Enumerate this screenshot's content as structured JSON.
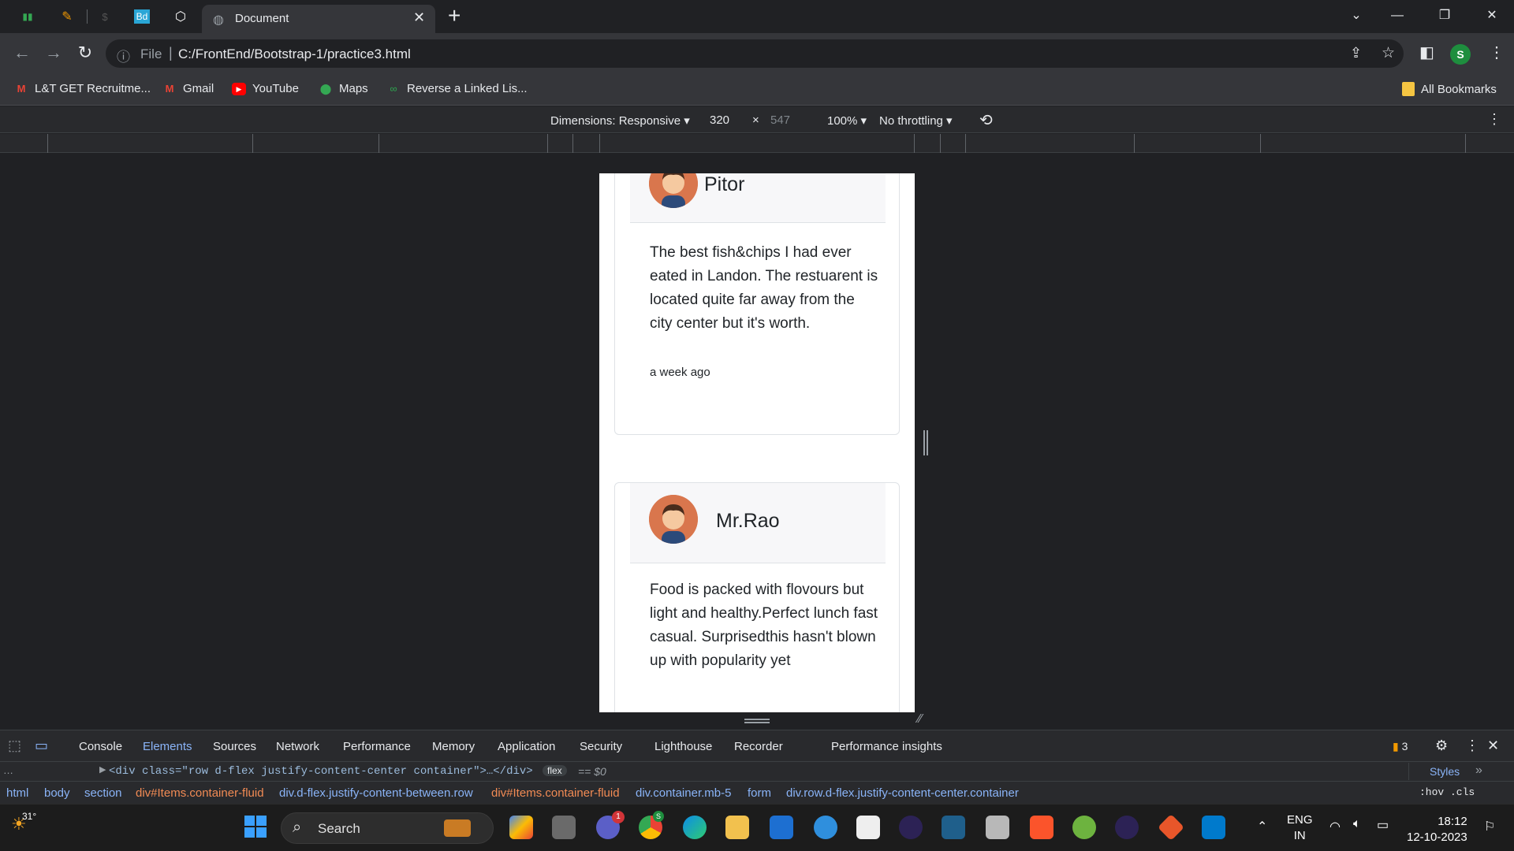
{
  "browser": {
    "tab_title": "Document",
    "url_prefix": "File",
    "url": "C:/FrontEnd/Bootstrap-1/practice3.html",
    "profile_initial": "S"
  },
  "bookmarks": [
    {
      "label": "L&T GET Recruitme...",
      "icon": "gmail-icon"
    },
    {
      "label": "Gmail",
      "icon": "gmail-icon"
    },
    {
      "label": "YouTube",
      "icon": "youtube-icon"
    },
    {
      "label": "Maps",
      "icon": "maps-icon"
    },
    {
      "label": "Reverse a Linked Lis...",
      "icon": "link-icon"
    }
  ],
  "all_bookmarks": "All Bookmarks",
  "device_toolbar": {
    "dimensions": "Dimensions: Responsive",
    "width": "320",
    "times": "×",
    "height": "547",
    "zoom": "100%",
    "throttling": "No throttling"
  },
  "page": {
    "reviews": [
      {
        "name": "Pitor",
        "text": "The best fish&chips I had ever eated in Landon. The restuarent is located quite far away from the city center but it's worth.",
        "time": "a week ago"
      },
      {
        "name": "Mr.Rao",
        "text": "Food is packed with flovours but light and healthy.Perfect lunch fast casual. Surprisedthis hasn't blown up with popularity yet",
        "time": ""
      }
    ]
  },
  "devtools": {
    "tabs": [
      "Console",
      "Elements",
      "Sources",
      "Network",
      "Performance",
      "Memory",
      "Application",
      "Security",
      "Lighthouse",
      "Recorder",
      "Performance insights"
    ],
    "active_tab": "Elements",
    "issues_count": "3",
    "dom_line": "<div class=\"row d-flex justify-content-center container\">…</div>",
    "dom_badge": "flex",
    "dom_eq": "== $0",
    "styles_tab": "Styles",
    "styles_filter": ":hov  .cls",
    "breadcrumbs": [
      "html",
      "body",
      "section",
      "div#Items.container-fluid",
      "div.d-flex.justify-content-between.row",
      "div#Items.container-fluid",
      "div.container.mb-5",
      "form",
      "div.row.d-flex.justify-content-center.container"
    ]
  },
  "taskbar": {
    "temperature": "31°",
    "search": "Search",
    "lang": "ENG",
    "region": "IN",
    "time": "18:12",
    "date": "12-10-2023",
    "chrome_badge": "S",
    "teams_badge": "1"
  },
  "colors": {
    "accent": "#8ab4f8",
    "avatar": "#d9764d",
    "profile": "#1e8e3e"
  }
}
